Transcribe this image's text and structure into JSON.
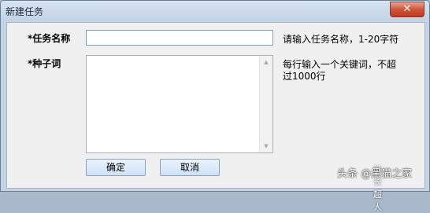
{
  "window": {
    "title": "新建任务",
    "close_glyph": "✕"
  },
  "form": {
    "task_name": {
      "required_mark": "*",
      "label": "任务名称",
      "value": "",
      "hint": "请输入任务名称，1-20字符"
    },
    "seed_words": {
      "required_mark": "*",
      "label": "种子词",
      "value": "",
      "hint_line1": "每行输入一个关键词，不超",
      "hint_line2": "过1000行"
    }
  },
  "buttons": {
    "confirm_label": "确定",
    "cancel_label": "取消"
  },
  "scrollbar": {
    "up_glyph": "▲",
    "down_glyph": "▼"
  },
  "watermark": {
    "text": "头条 @黑猫之家",
    "icon_text": "站长超人"
  }
}
